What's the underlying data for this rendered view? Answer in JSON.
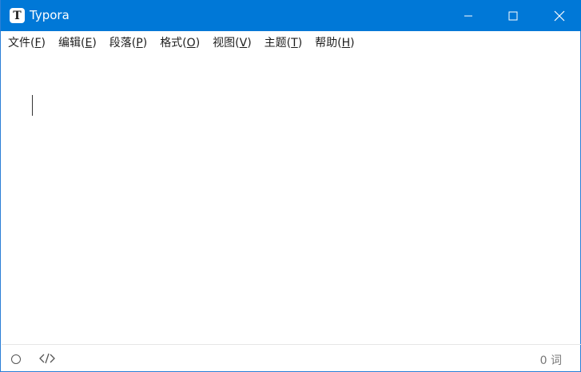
{
  "window": {
    "title": "Typora",
    "app_icon_letter": "T",
    "accent_color": "#0078d7"
  },
  "menubar": {
    "items": [
      {
        "label": "文件(",
        "accel": "F",
        "close": ")"
      },
      {
        "label": "编辑(",
        "accel": "E",
        "close": ")"
      },
      {
        "label": "段落(",
        "accel": "P",
        "close": ")"
      },
      {
        "label": "格式(",
        "accel": "O",
        "close": ")"
      },
      {
        "label": "视图(",
        "accel": "V",
        "close": ")"
      },
      {
        "label": "主题(",
        "accel": "T",
        "close": ")"
      },
      {
        "label": "帮助(",
        "accel": "H",
        "close": ")"
      }
    ]
  },
  "statusbar": {
    "word_count": "0 词",
    "icons": [
      "outline-toggle-icon",
      "source-code-icon"
    ]
  }
}
